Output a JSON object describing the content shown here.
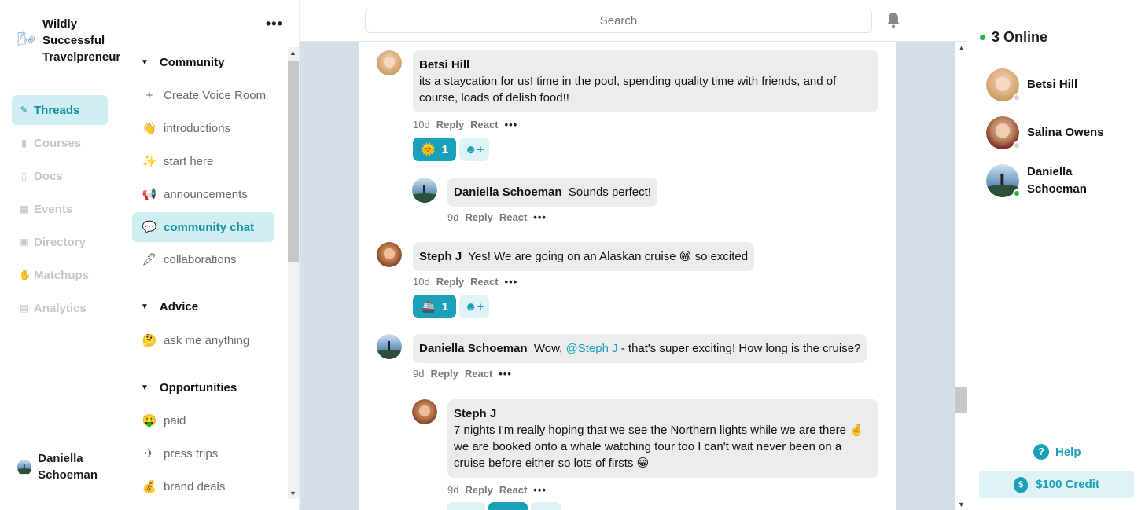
{
  "brand": {
    "name": "Wildly Successful Travelpreneurs"
  },
  "nav": {
    "items": [
      {
        "label": "Threads",
        "icon": "leaf-icon",
        "active": true
      },
      {
        "label": "Courses",
        "icon": "book-icon"
      },
      {
        "label": "Docs",
        "icon": "document-icon"
      },
      {
        "label": "Events",
        "icon": "calendar-icon"
      },
      {
        "label": "Directory",
        "icon": "contact-card-icon"
      },
      {
        "label": "Matchups",
        "icon": "hand-icon"
      },
      {
        "label": "Analytics",
        "icon": "chart-icon"
      }
    ],
    "current_user": "Daniella Schoeman"
  },
  "channels": {
    "more_label": "•••",
    "sections": [
      {
        "title": "Community",
        "items": [
          {
            "label": "Create Voice Room",
            "icon": "+"
          },
          {
            "label": "introductions",
            "icon": "👋"
          },
          {
            "label": "start here",
            "icon": "✨"
          },
          {
            "label": "announcements",
            "icon": "📢"
          },
          {
            "label": "community chat",
            "icon": "💬",
            "active": true
          },
          {
            "label": "collaborations",
            "icon": "🖋"
          }
        ]
      },
      {
        "title": "Advice",
        "items": [
          {
            "label": "ask me anything",
            "icon": "🤔"
          }
        ]
      },
      {
        "title": "Opportunities",
        "items": [
          {
            "label": "paid",
            "icon": "🤑"
          },
          {
            "label": "press trips",
            "icon": "✈"
          },
          {
            "label": "brand deals",
            "icon": "💰"
          }
        ]
      }
    ]
  },
  "search": {
    "placeholder": "Search"
  },
  "messages": [
    {
      "author": "Betsi Hill",
      "text": "its a staycation for us! time in the pool, spending quality time with friends, and of course, loads of delish food!!",
      "age": "10d",
      "reply": "Reply",
      "react": "React",
      "reactions": [
        {
          "emoji": "🌞",
          "count": "1"
        }
      ]
    },
    {
      "author": "Daniella Schoeman",
      "text": "Sounds perfect!",
      "age": "9d",
      "reply": "Reply",
      "react": "React"
    },
    {
      "author": "Steph J",
      "text": "Yes! We are going on an Alaskan cruise 😁 so excited",
      "age": "10d",
      "reply": "Reply",
      "react": "React",
      "reactions": [
        {
          "emoji": "🚢",
          "count": "1"
        }
      ]
    },
    {
      "author": "Daniella Schoeman",
      "text_before": "Wow, ",
      "mention": "@Steph J",
      "text_after": " - that's super exciting! How long is the cruise?",
      "age": "9d",
      "reply": "Reply",
      "react": "React"
    },
    {
      "author": "Steph J",
      "text": "7 nights I'm really hoping that we see the Northern lights while we are there 🤞 we are booked onto a whale watching tour too I can't wait never been on a cruise before either so lots of firsts 😁",
      "age": "9d",
      "reply": "Reply",
      "react": "React"
    }
  ],
  "meta_dots": "•••",
  "online": {
    "title": "3 Online",
    "members": [
      {
        "name": "Betsi Hill",
        "status": "away"
      },
      {
        "name": "Salina Owens",
        "status": "away"
      },
      {
        "name": "Daniella Schoeman",
        "status": "online"
      }
    ]
  },
  "help": {
    "label": "Help",
    "icon": "?"
  },
  "credit": {
    "label": "$100 Credit",
    "icon": "$"
  },
  "colors": {
    "accent": "#1aa0b8",
    "active_bg": "#cfeff2",
    "center_bg": "#d5dfea",
    "online": "#21b24b"
  }
}
